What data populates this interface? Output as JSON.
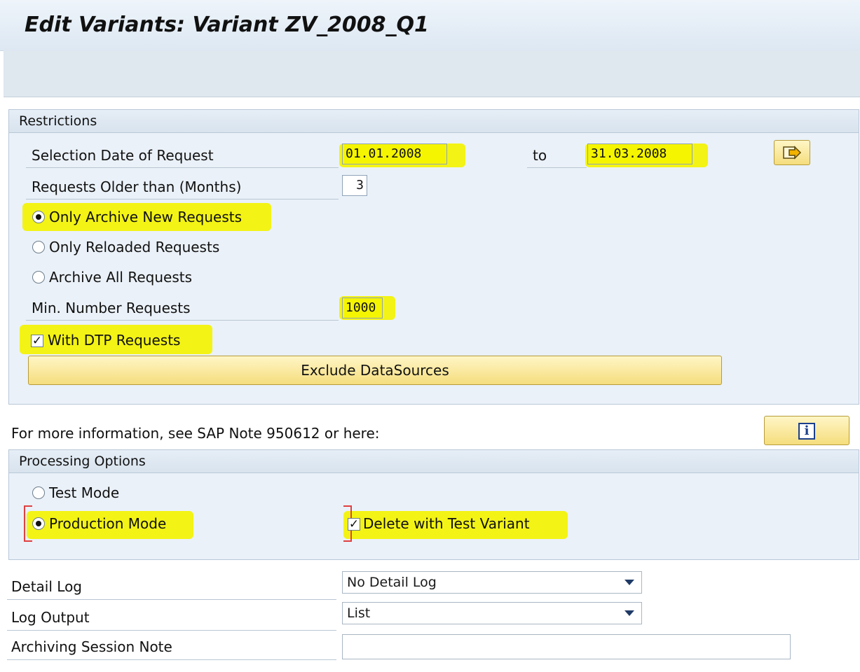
{
  "window": {
    "title": "Edit Variants: Variant ZV_2008_Q1"
  },
  "restrictions": {
    "heading": "Restrictions",
    "selection_date_label": "Selection Date of Request",
    "date_from": "01.01.2008",
    "to_label": "to",
    "date_to": "31.03.2008",
    "older_than_label": "Requests Older than (Months)",
    "older_than_value": "3",
    "radio_new": "Only Archive New Requests",
    "radio_reloaded": "Only Reloaded Requests",
    "radio_all": "Archive All Requests",
    "min_number_label": "Min. Number Requests",
    "min_number_value": "1000",
    "dtp_label": "With DTP Requests",
    "dtp_checked": true,
    "exclude_button": "Exclude DataSources"
  },
  "info": {
    "text": "For more information, see SAP Note 950612 or here:",
    "info_icon_glyph": "i"
  },
  "processing": {
    "heading": "Processing Options",
    "test_mode": "Test Mode",
    "production_mode": "Production Mode",
    "delete_test_variant": "Delete with Test Variant",
    "delete_checked": true,
    "check_glyph": "✓"
  },
  "log": {
    "detail_log_label": "Detail Log",
    "detail_log_value": "No Detail Log",
    "log_output_label": "Log Output",
    "log_output_value": "List",
    "session_note_label": "Archiving Session Note",
    "session_note_value": ""
  },
  "colors": {
    "highlight": "#f3f20a",
    "button": "#f5dd7d",
    "group_bg": "#eaf1f8"
  }
}
